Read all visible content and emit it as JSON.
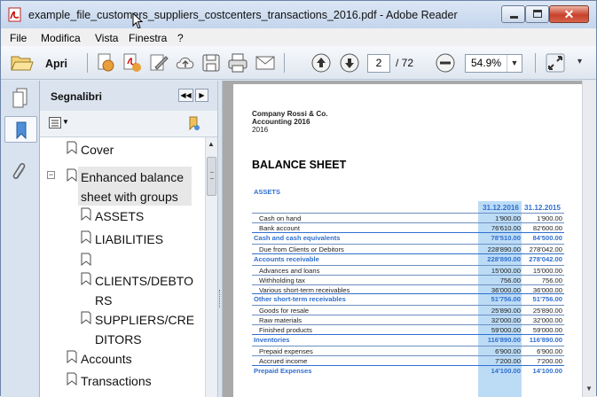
{
  "window": {
    "title": "example_file_customers_suppliers_costcenters_transactions_2016.pdf - Adobe Reader"
  },
  "menu": [
    "File",
    "Modifica",
    "Vista",
    "Finestra",
    "?"
  ],
  "toolbar": {
    "open_label": "Apri",
    "page_current": "2",
    "page_total": "/ 72",
    "zoom": "54.9%"
  },
  "bookmarks": {
    "title": "Segnalibri",
    "items": [
      {
        "label": "Cover"
      },
      {
        "label_line1": "Enhanced balance",
        "label_line2": "sheet with groups"
      },
      {
        "label": "ASSETS"
      },
      {
        "label": "LIABILITIES"
      },
      {
        "label": ""
      },
      {
        "label_line1": "CLIENTS/DEBTO",
        "label_line2": "RS"
      },
      {
        "label_line1": "SUPPLIERS/CRE",
        "label_line2": "DITORS"
      },
      {
        "label": "Accounts"
      },
      {
        "label": "Transactions"
      }
    ]
  },
  "document": {
    "company": "Company Rossi & Co.",
    "subtitle": "Accounting 2016",
    "year": "2016",
    "heading": "BALANCE SHEET",
    "section": "ASSETS",
    "col1": "31.12.2016",
    "col2": "31.12.2015",
    "rows": [
      {
        "label": "Cash on hand",
        "v1": "1'900.00",
        "v2": "1'900.00",
        "total": false
      },
      {
        "label": "Bank account",
        "v1": "76'610.00",
        "v2": "82'600.00",
        "total": false
      },
      {
        "label": "Cash and cash equivalents",
        "v1": "78'510.00",
        "v2": "84'500.00",
        "total": true
      },
      {
        "label": "Due from Clients or Debitors",
        "v1": "228'890.00",
        "v2": "278'042.00",
        "total": false
      },
      {
        "label": "Accounts receivable",
        "v1": "228'890.00",
        "v2": "278'042.00",
        "total": true
      },
      {
        "label": "Advances and loans",
        "v1": "15'000.00",
        "v2": "15'000.00",
        "total": false
      },
      {
        "label": "Withholding tax",
        "v1": "756.00",
        "v2": "756.00",
        "total": false
      },
      {
        "label": "Various short-term receivables",
        "v1": "36'000.00",
        "v2": "36'000.00",
        "total": false
      },
      {
        "label": "Other short-term receivables",
        "v1": "51'756.00",
        "v2": "51'756.00",
        "total": true
      },
      {
        "label": "Goods for resale",
        "v1": "25'890.00",
        "v2": "25'890.00",
        "total": false
      },
      {
        "label": "Raw materials",
        "v1": "32'000.00",
        "v2": "32'000.00",
        "total": false
      },
      {
        "label": "Finished products",
        "v1": "59'000.00",
        "v2": "59'000.00",
        "total": false
      },
      {
        "label": "Inventories",
        "v1": "116'890.00",
        "v2": "116'890.00",
        "total": true
      },
      {
        "label": "Prepaid expenses",
        "v1": "6'900.00",
        "v2": "6'900.00",
        "total": false
      },
      {
        "label": "Accrued income",
        "v1": "7'200.00",
        "v2": "7'200.00",
        "total": false
      },
      {
        "label": "Prepaid Expenses",
        "v1": "14'100.00",
        "v2": "14'100.00",
        "total": true
      }
    ]
  },
  "colors": {
    "accent_blue": "#2f6fd0",
    "highlight_cell": "#bcdcf6",
    "titlebar": "#c9d8ec"
  }
}
